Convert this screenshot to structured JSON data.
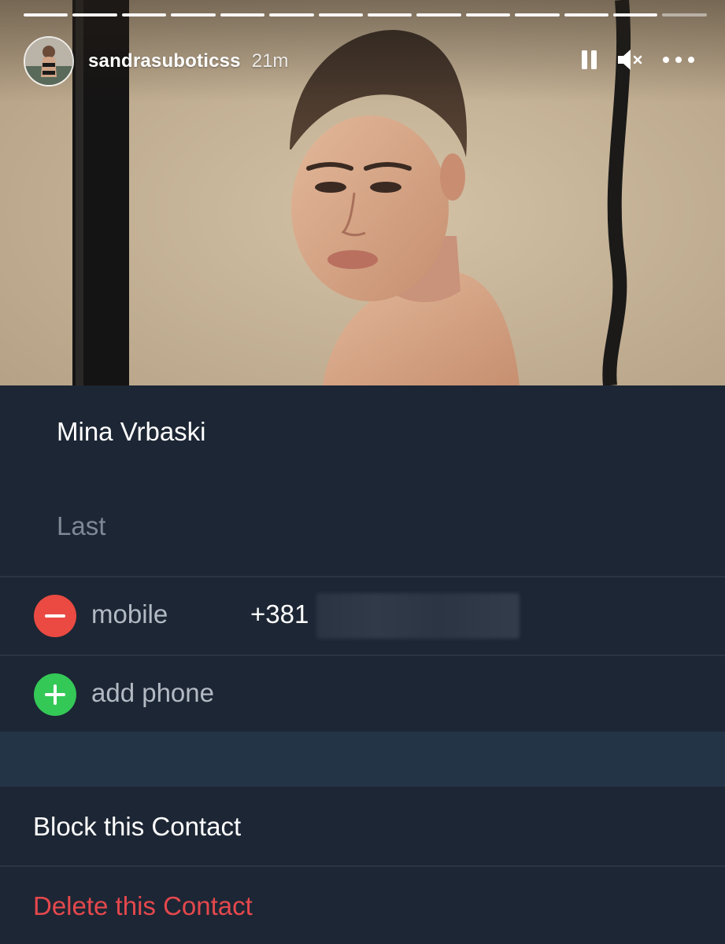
{
  "story": {
    "username": "sandrasuboticss",
    "time_ago": "21m",
    "progress_segments_total": 14,
    "progress_segments_seen": 13,
    "icons": {
      "pause": "pause-icon",
      "mute": "speaker-muted-icon",
      "more": "more-options-icon"
    }
  },
  "contact": {
    "first_name": "Mina Vrbaski",
    "last_name_placeholder": "Last",
    "phones": [
      {
        "label": "mobile",
        "number_visible": "+381",
        "action_icon": "remove-circle-icon"
      }
    ],
    "add_phone_label": "add phone",
    "add_phone_icon": "add-circle-icon",
    "block_label": "Block this Contact",
    "delete_label": "Delete this Contact"
  },
  "colors": {
    "sheet_background": "#1d2634",
    "band_background": "#243447",
    "remove": "#ea4a42",
    "add": "#34c857",
    "delete_text": "#e5484d",
    "placeholder_text": "#7f8895"
  }
}
